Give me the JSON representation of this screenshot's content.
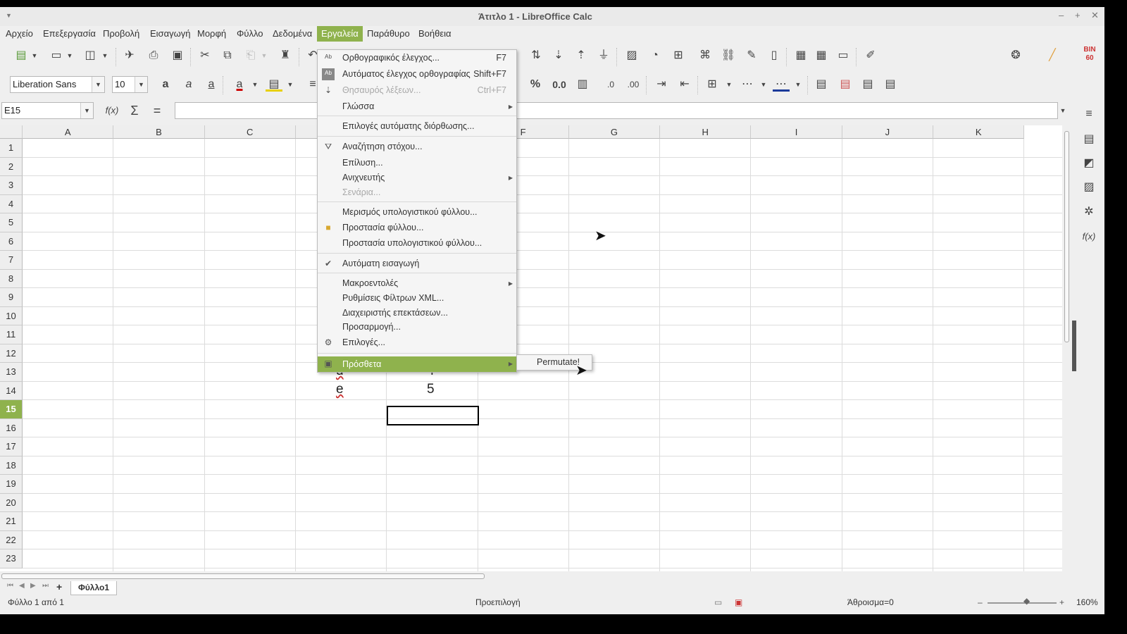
{
  "window": {
    "title": "Άτιτλο 1 - LibreOffice Calc",
    "menu_icon": "chevron-down-icon",
    "minimize": "–",
    "maximize": "+",
    "close": "✕"
  },
  "menubar": [
    "Αρχείο",
    "Επεξεργασία",
    "Προβολή",
    "Εισαγωγή",
    "Μορφή",
    "Φύλλο",
    "Δεδομένα",
    "Εργαλεία",
    "Παράθυρο",
    "Βοήθεια"
  ],
  "active_menu": "Εργαλεία",
  "formatting": {
    "font_name": "Liberation Sans",
    "font_size": "10"
  },
  "formula_bar": {
    "name_box": "E15",
    "fx": "f(x)",
    "sum": "Σ",
    "equals": "=",
    "content": ""
  },
  "columns": [
    "A",
    "B",
    "C",
    "D",
    "E",
    "F",
    "G",
    "H",
    "I",
    "J",
    "K"
  ],
  "rows": [
    "1",
    "2",
    "3",
    "4",
    "5",
    "6",
    "7",
    "8",
    "9",
    "10",
    "11",
    "12",
    "13",
    "14",
    "15",
    "16",
    "17",
    "18",
    "19",
    "20",
    "21",
    "22",
    "23"
  ],
  "active_row": "15",
  "cells": [
    {
      "ref": "D13",
      "value": "d"
    },
    {
      "ref": "E13",
      "value": "4"
    },
    {
      "ref": "D14",
      "value": "e"
    },
    {
      "ref": "E14",
      "value": "5"
    }
  ],
  "tools_menu": {
    "items": [
      {
        "label": "Ορθογραφικός έλεγχος...",
        "shortcut": "F7",
        "icon": "spellcheck-icon"
      },
      {
        "label": "Αυτόματος έλεγχος ορθογραφίας",
        "shortcut": "Shift+F7",
        "icon": "autospellcheck-icon"
      },
      {
        "label": "Θησαυρός λέξεων...",
        "shortcut": "Ctrl+F7",
        "disabled": true,
        "icon": "thesaurus-icon"
      },
      {
        "label": "Γλώσσα",
        "submenu": true
      },
      {
        "label": "Επιλογές αυτόματης διόρθωσης..."
      },
      {
        "label": "Αναζήτηση στόχου...",
        "icon": "goal-seek-icon"
      },
      {
        "label": "Επίλυση..."
      },
      {
        "label": "Ανιχνευτής",
        "submenu": true
      },
      {
        "label": "Σενάρια...",
        "disabled": true
      },
      {
        "label": "Μερισμός υπολογιστικού φύλλου..."
      },
      {
        "label": "Προστασία φύλλου...",
        "icon": "lock-icon"
      },
      {
        "label": "Προστασία υπολογιστικού φύλλου..."
      },
      {
        "label": "Αυτόματη εισαγωγή",
        "checked": true
      },
      {
        "label": "Μακροεντολές",
        "submenu": true
      },
      {
        "label": "Ρυθμίσεις Φίλτρων XML..."
      },
      {
        "label": "Διαχειριστής επεκτάσεων..."
      },
      {
        "label": "Προσαρμογή..."
      },
      {
        "label": "Επιλογές...",
        "icon": "gear-icon"
      },
      {
        "label": "Πρόσθετα",
        "submenu": true,
        "highlighted": true,
        "icon": "addons-icon"
      }
    ],
    "addons_submenu": [
      "Permutate!"
    ]
  },
  "sheet_tabs": [
    "Φύλλο1"
  ],
  "status": {
    "sheet": "Φύλλο 1 από 1",
    "page_style": "Προεπιλογή",
    "sum": "Άθροισμα=0",
    "zoom": "160%"
  }
}
